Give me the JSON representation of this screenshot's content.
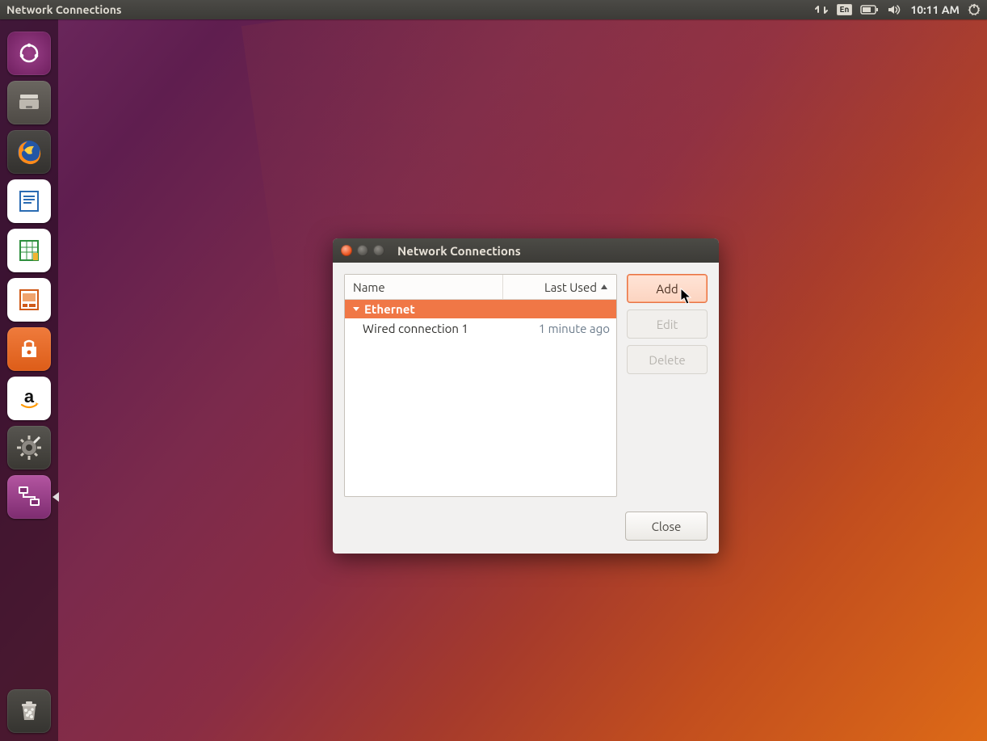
{
  "menubar": {
    "app_title": "Network Connections",
    "lang": "En",
    "clock": "10:11 AM"
  },
  "dialog": {
    "title": "Network Connections",
    "columns": {
      "name": "Name",
      "last_used": "Last Used"
    },
    "groups": [
      {
        "label": "Ethernet",
        "rows": [
          {
            "name": "Wired connection 1",
            "last_used": "1 minute ago"
          }
        ]
      }
    ],
    "buttons": {
      "add": "Add",
      "edit": "Edit",
      "delete": "Delete",
      "close": "Close"
    }
  }
}
